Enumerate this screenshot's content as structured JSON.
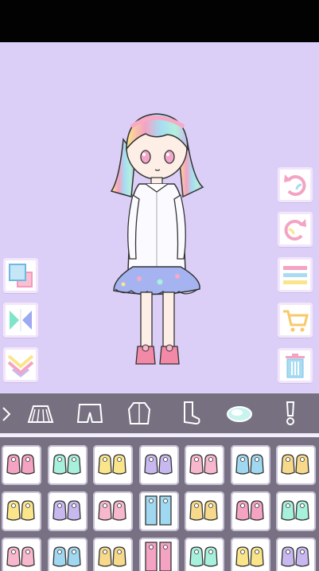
{
  "colors": {
    "background": "#dccff7",
    "status_bar": "#020202",
    "category_bar": "#767080",
    "items_panel": "#777183",
    "accent_pink": "#f4a3c2",
    "accent_blue": "#a7dcf3",
    "accent_yellow": "#fbe58b"
  },
  "left_tools": [
    {
      "name": "layer-swap-icon"
    },
    {
      "name": "flip-icon"
    },
    {
      "name": "collapse-chevron-icon"
    }
  ],
  "right_tools": [
    {
      "name": "undo-icon"
    },
    {
      "name": "redo-icon"
    },
    {
      "name": "menu-icon"
    },
    {
      "name": "cart-icon"
    },
    {
      "name": "trash-icon"
    }
  ],
  "categories": [
    {
      "name": "partial-tab-icon"
    },
    {
      "name": "skirt-icon"
    },
    {
      "name": "shorts-icon"
    },
    {
      "name": "jacket-icon"
    },
    {
      "name": "socks-icon"
    },
    {
      "name": "shoes-icon",
      "selected": true
    },
    {
      "name": "accessory-icon"
    }
  ],
  "item_rows": [
    [
      "pink-boots-icon",
      "mint-shoes-icon",
      "yellow-lace-sandals-icon",
      "lavender-fur-boots-icon",
      "pink-flats-icon",
      "mint-flats-icon",
      "yellow-flats-icon"
    ],
    [
      "pink-low-shoes-icon",
      "blue-bow-shoes-icon",
      "pink-frill-socks-icon",
      "mint-tall-socks-icon",
      "navy-bow-socks-icon",
      "pink-ankle-socks-icon",
      "yellow-frill-socks-icon"
    ],
    [
      "pink-sneakers-icon",
      "teal-sneakers-icon",
      "blue-strap-shoes-icon",
      "purple-tall-socks-icon",
      "blue-fluffy-boots-icon",
      "navy-sneakers-icon",
      "extra-item-icon"
    ]
  ]
}
